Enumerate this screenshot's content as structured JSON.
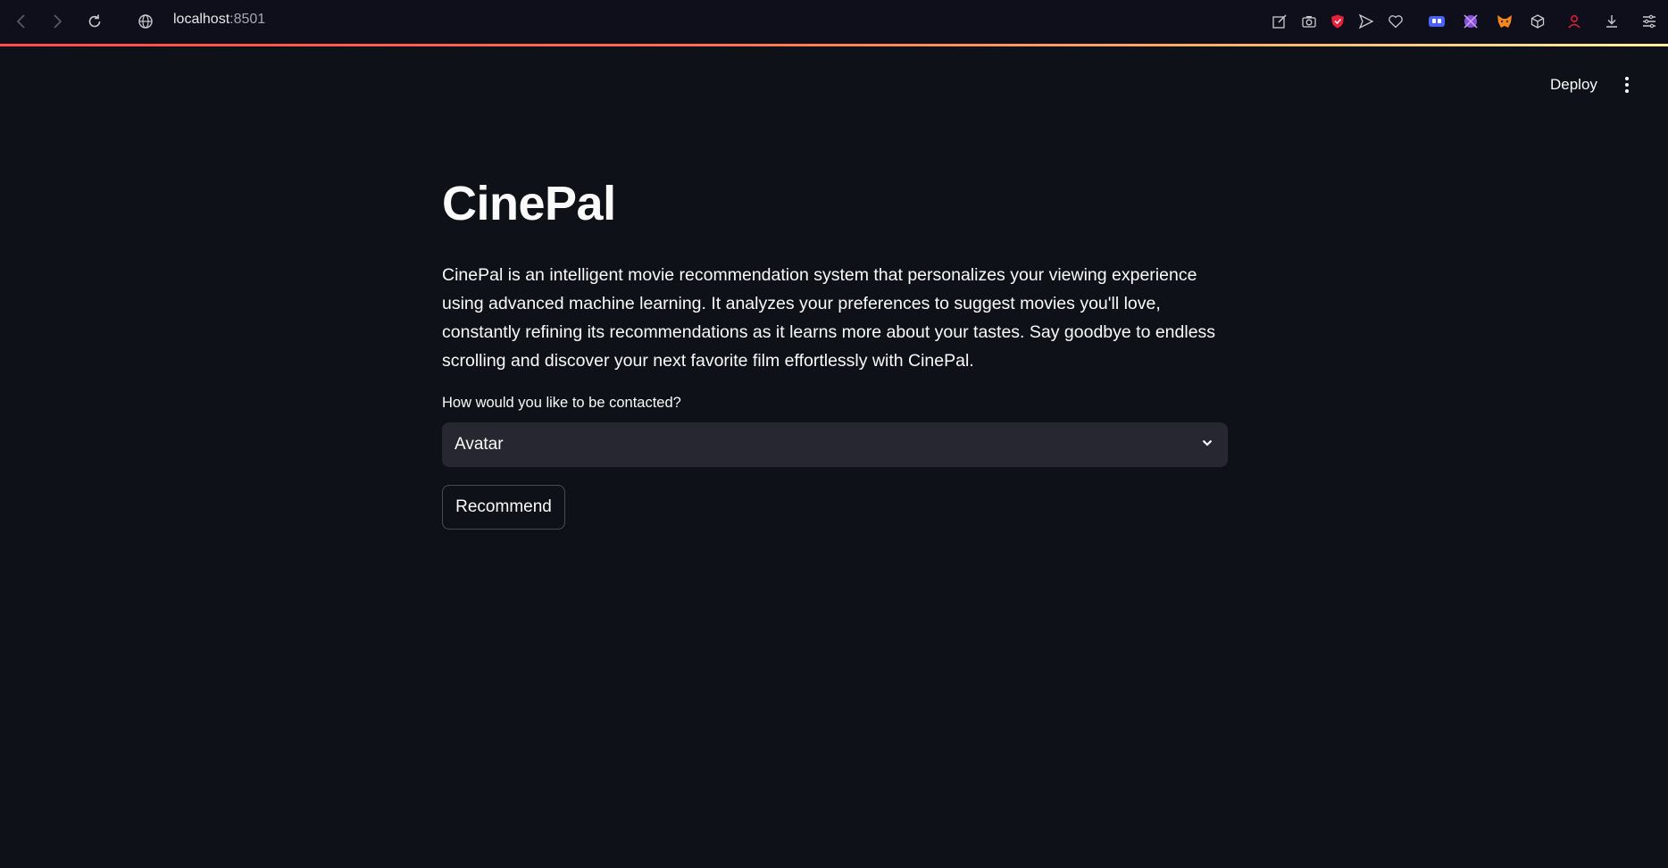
{
  "browser": {
    "url_host": "localhost",
    "url_port": ":8501",
    "icons": [
      "back-icon",
      "forward-icon",
      "reload-icon",
      "site-info-icon",
      "edit-icon",
      "camera-icon",
      "shield-icon",
      "send-icon",
      "heart-icon",
      "extension-icon-1",
      "extension-icon-2",
      "metamask-icon",
      "cube-icon",
      "profile-icon",
      "download-icon",
      "menu-icon"
    ]
  },
  "header": {
    "deploy_label": "Deploy"
  },
  "main": {
    "title": "CinePal",
    "description": "CinePal is an intelligent movie recommendation system that personalizes your viewing experience using advanced machine learning. It analyzes your preferences to suggest movies you'll love, constantly refining its recommendations as it learns more about your tastes. Say goodbye to endless scrolling and discover your next favorite film effortlessly with CinePal.",
    "select_label": "How would you like to be contacted?",
    "select_value": "Avatar",
    "button_label": "Recommend"
  },
  "colors": {
    "background": "#0e1117",
    "select_bg": "#262730",
    "accent_red": "#ff4b4b"
  }
}
